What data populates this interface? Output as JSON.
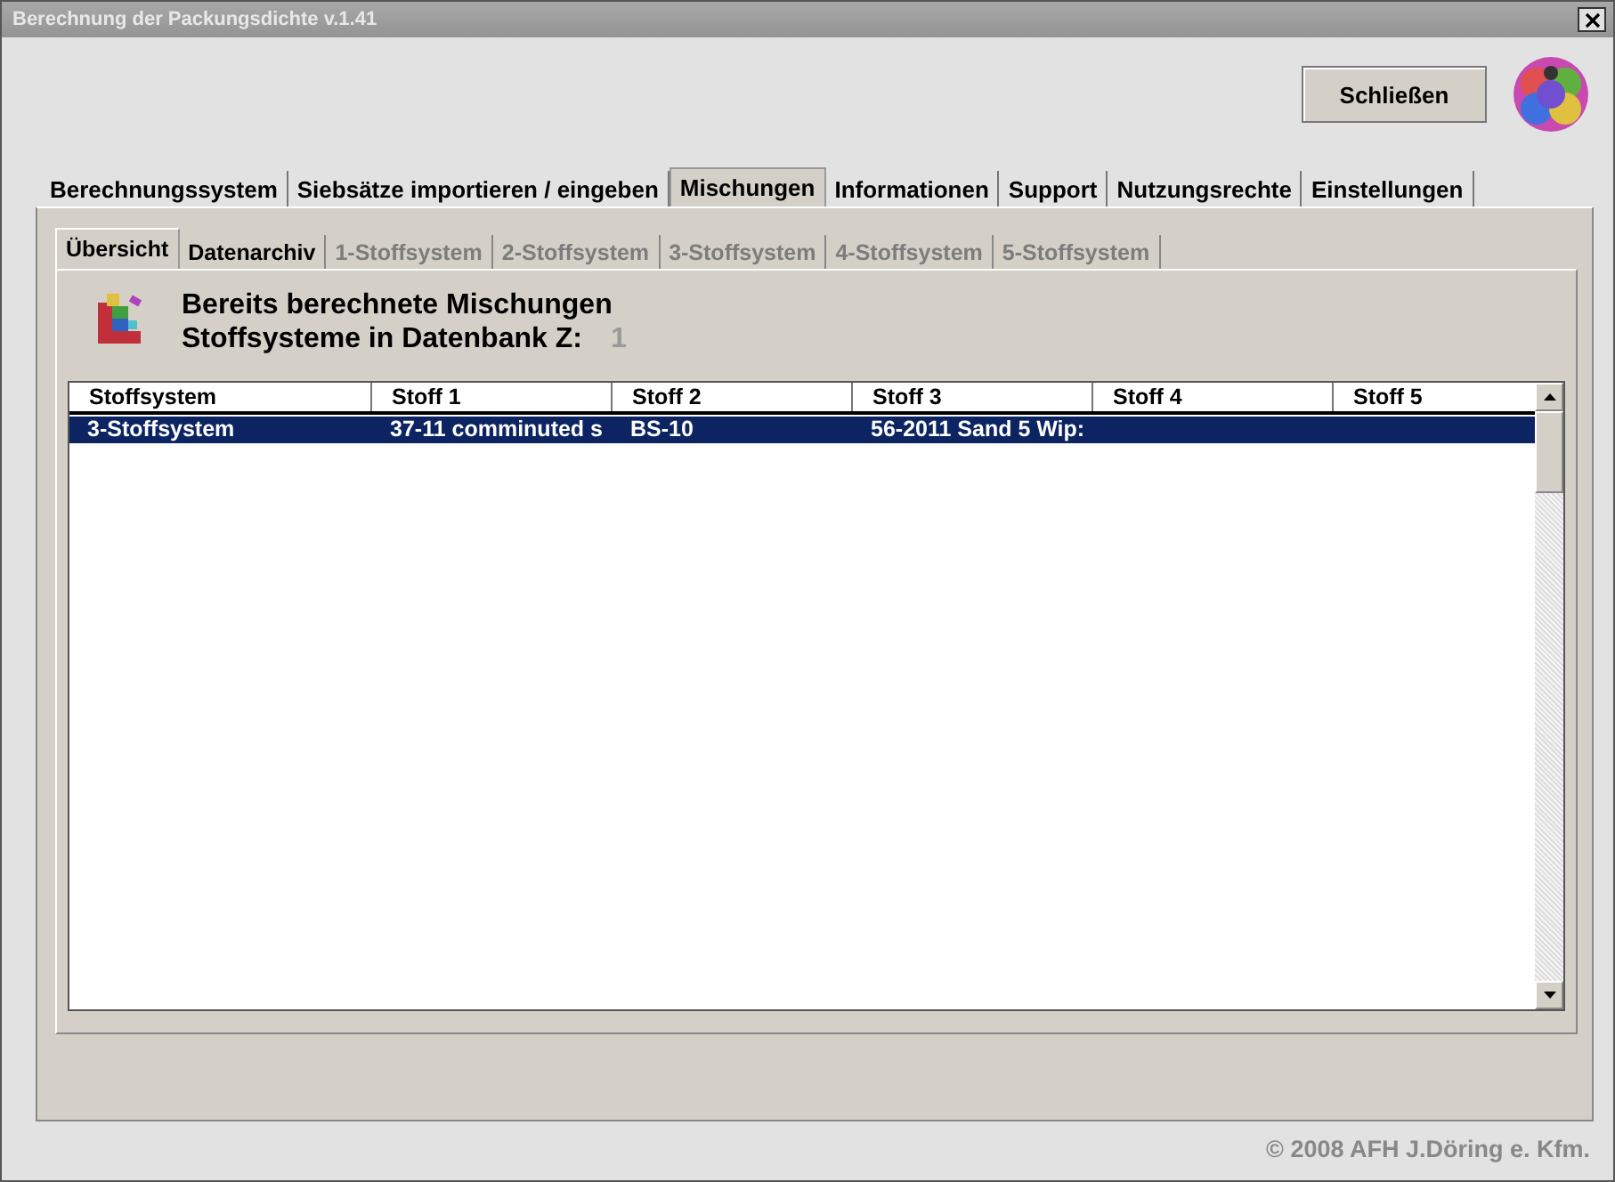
{
  "window": {
    "title": "Berechnung der Packungsdichte v.1.41"
  },
  "close_button": {
    "label": "Schließen"
  },
  "tabs": [
    {
      "label": "Berechnungssystem",
      "selected": false
    },
    {
      "label": "Siebsätze importieren / eingeben",
      "selected": false
    },
    {
      "label": "Mischungen",
      "selected": true
    },
    {
      "label": "Informationen",
      "selected": false
    },
    {
      "label": "Support",
      "selected": false
    },
    {
      "label": "Nutzungsrechte",
      "selected": false
    },
    {
      "label": "Einstellungen",
      "selected": false
    }
  ],
  "subtabs": [
    {
      "label": "Übersicht",
      "selected": true,
      "disabled": false
    },
    {
      "label": "Datenarchiv",
      "selected": false,
      "disabled": false
    },
    {
      "label": "1-Stoffsystem",
      "selected": false,
      "disabled": true
    },
    {
      "label": "2-Stoffsystem",
      "selected": false,
      "disabled": true
    },
    {
      "label": "3-Stoffsystem",
      "selected": false,
      "disabled": true
    },
    {
      "label": "4-Stoffsystem",
      "selected": false,
      "disabled": true
    },
    {
      "label": "5-Stoffsystem",
      "selected": false,
      "disabled": true
    }
  ],
  "heading": "Bereits berechnete Mischungen",
  "count_label": "Stoffsysteme in Datenbank Z:",
  "count": "1",
  "table": {
    "columns": [
      "Stoffsystem",
      "Stoff 1",
      "Stoff 2",
      "Stoff 3",
      "Stoff 4",
      "Stoff 5"
    ],
    "rows": [
      {
        "cells": [
          "3-Stoffsystem",
          "37-11 comminuted s",
          "BS-10",
          "56-2011 Sand 5 Wip:",
          "",
          ""
        ],
        "selected": true
      }
    ]
  },
  "footer": "© 2008  AFH J.Döring e. Kfm."
}
